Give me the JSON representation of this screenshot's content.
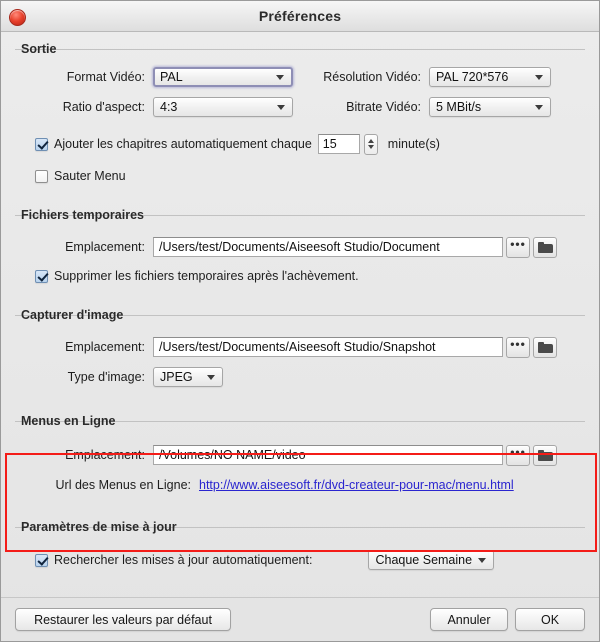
{
  "window": {
    "title": "Préférences",
    "close_icon": "close-icon"
  },
  "sections": {
    "sortie": {
      "title": "Sortie",
      "video_format_label": "Format Vidéo:",
      "video_format_value": "PAL",
      "resolution_label": "Résolution Vidéo:",
      "resolution_value": "PAL 720*576",
      "aspect_label": "Ratio d'aspect:",
      "aspect_value": "4:3",
      "bitrate_label": "Bitrate Vidéo:",
      "bitrate_value": "5 MBit/s",
      "auto_chapters_label": "Ajouter les chapitres automatiquement chaque",
      "auto_chapters_checked": true,
      "chapter_interval": "15",
      "chapter_unit": "minute(s)",
      "skip_menu_label": "Sauter Menu",
      "skip_menu_checked": false
    },
    "temp_files": {
      "title": "Fichiers temporaires",
      "location_label": "Emplacement:",
      "location_value": "/Users/test/Documents/Aiseesoft Studio/Document",
      "browse_dots": "•••",
      "delete_temp_label": "Supprimer les fichiers temporaires après l'achèvement.",
      "delete_temp_checked": true
    },
    "snapshot": {
      "title": "Capturer d'image",
      "location_label": "Emplacement:",
      "location_value": "/Users/test/Documents/Aiseesoft Studio/Snapshot",
      "browse_dots": "•••",
      "image_type_label": "Type d'image:",
      "image_type_value": "JPEG"
    },
    "online_menus": {
      "title": "Menus en Ligne",
      "location_label": "Emplacement:",
      "location_value": "/Volumes/NO NAME/video",
      "browse_dots": "•••",
      "url_label": "Url des Menus en Ligne:",
      "url_value": "http://www.aiseesoft.fr/dvd-createur-pour-mac/menu.html",
      "highlight_color": "#f41c18"
    },
    "update": {
      "title": "Paramètres de mise à jour",
      "auto_update_label": "Rechercher les mises à jour automatiquement:",
      "auto_update_checked": true,
      "frequency_value": "Chaque Semaine"
    }
  },
  "footer": {
    "restore_label": "Restaurer les valeurs par défaut",
    "cancel_label": "Annuler",
    "ok_label": "OK"
  }
}
